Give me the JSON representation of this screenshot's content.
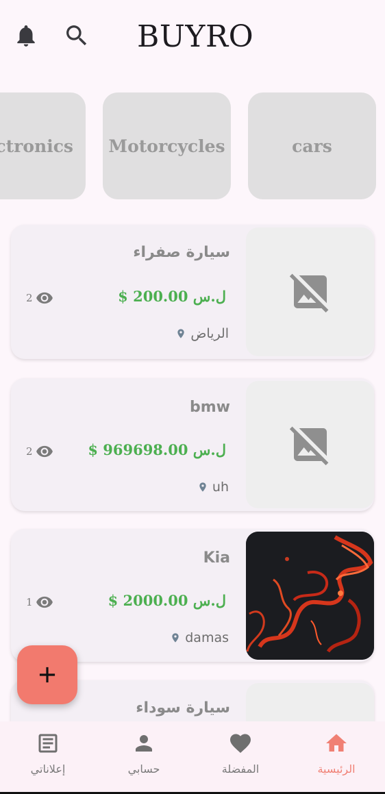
{
  "app": {
    "title": "BUYRO"
  },
  "categories": [
    {
      "label": "Electronics"
    },
    {
      "label": "Motorcycles"
    },
    {
      "label": "cars"
    }
  ],
  "listings": [
    {
      "name": "سيارة صفراء",
      "price": "$ 200.00 ل.س",
      "views": "2",
      "location": "الرياض",
      "image": "no-image-icon"
    },
    {
      "name": "bmw",
      "price": "$ 969698.00 ل.س",
      "views": "2",
      "location": "uh",
      "image": "no-image-icon"
    },
    {
      "name": "Kia",
      "price": "$ 2000.00 ل.س",
      "views": "1",
      "location": "damas",
      "image": "lava-photo"
    },
    {
      "name": "سيارة سوداء"
    }
  ],
  "bottom_nav": {
    "items": [
      {
        "label": "إعلاناتي",
        "icon": "article-icon"
      },
      {
        "label": "حسابي",
        "icon": "person-icon"
      },
      {
        "label": "المفضلة",
        "icon": "heart-icon"
      },
      {
        "label": "الرئيسية",
        "icon": "home-icon",
        "active": true
      }
    ]
  },
  "colors": {
    "accent": "#f27a6e",
    "price": "#4caf50",
    "background": "#fdf6fb"
  }
}
